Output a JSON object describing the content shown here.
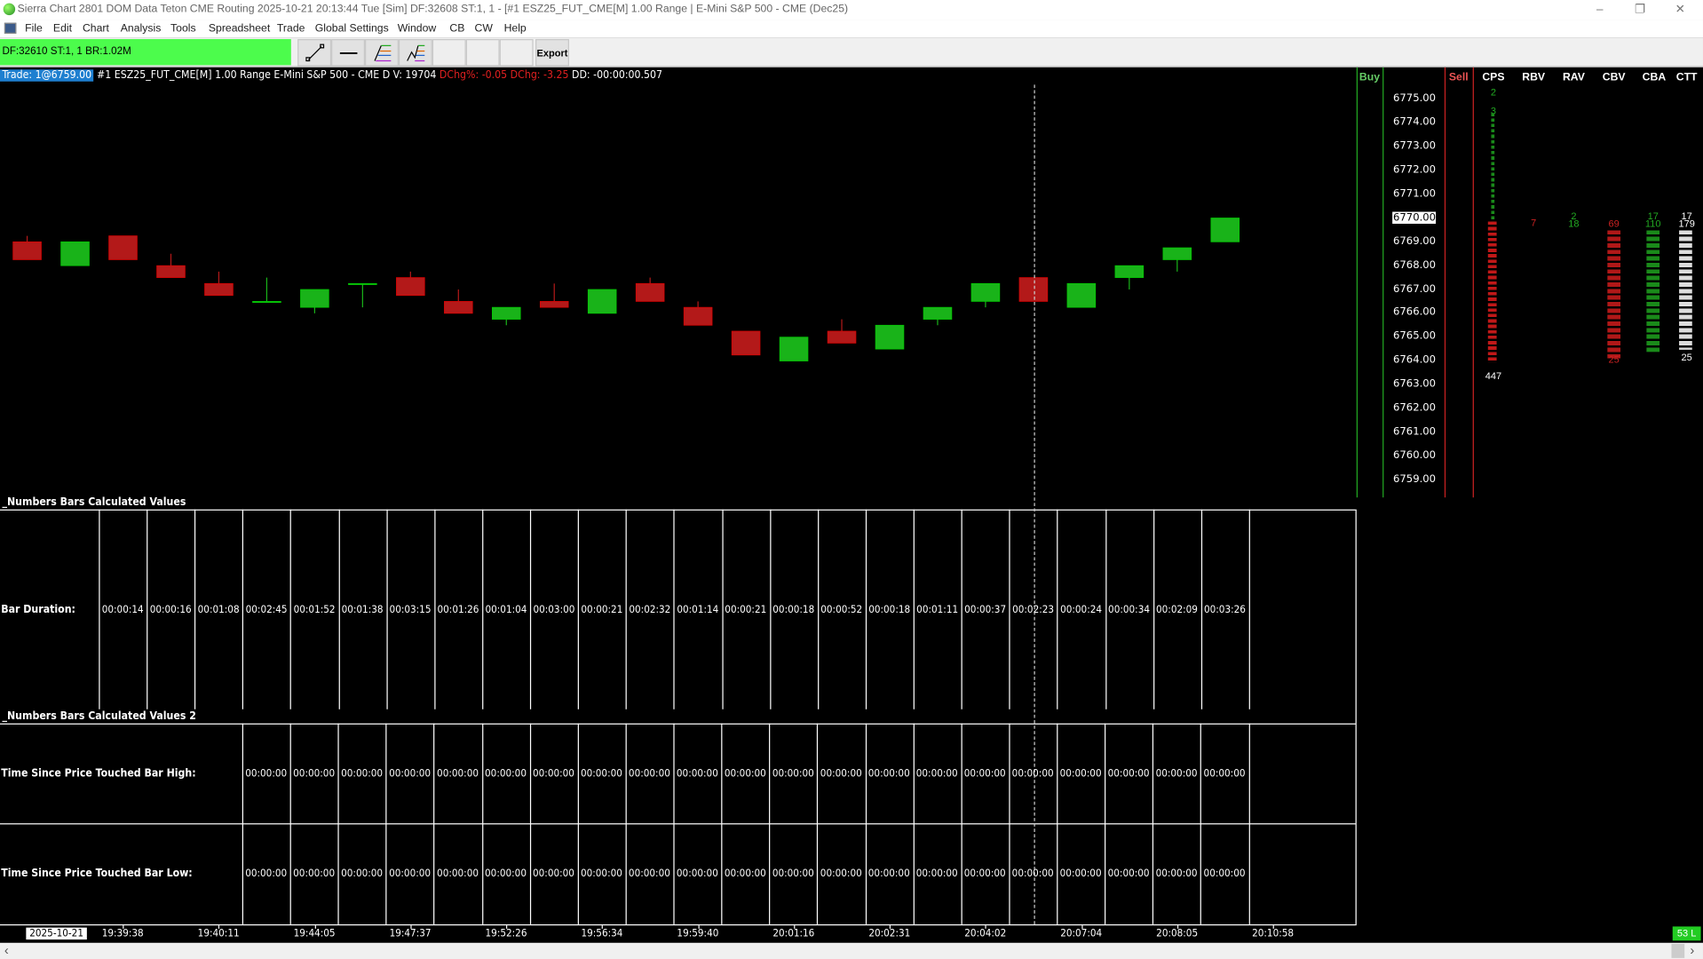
{
  "window": {
    "title": "Sierra Chart 2801 DOM Data Teton CME Routing 2025-10-21  20:13:44 Tue [Sim] DF:32608  ST:1, 1 - [#1 ESZ25_FUT_CME[M]  1.00 Range | E-Mini S&P 500 - CME (Dec25)",
    "minimize": "–",
    "restore": "❐",
    "close": "✕"
  },
  "menu": [
    "File",
    "Edit",
    "Chart",
    "Analysis",
    "Tools",
    "Spreadsheet",
    "Trade",
    "Global Settings",
    "Window",
    "CB",
    "CW",
    "Help"
  ],
  "toolbar": {
    "status": "DF:32610  ST:1, 1  BR:1.02M",
    "export_label": "Export",
    "tools": [
      "line-tool",
      "horizontal-line-tool",
      "fib-retracement-tool",
      "fib-extension-tool"
    ]
  },
  "info": {
    "trade": "Trade: 1@6759.00",
    "symbol": "#1 ESZ25_FUT_CME[M]  1.00 Range E-Mini S&P 500 - CME D V: 19704",
    "dchg_pct": "DChg%: -0.05",
    "dchg": "DChg: -3.25",
    "dd": "DD: -00:00:00.507"
  },
  "colors": {
    "up": "#19b319",
    "down": "#b31919",
    "status_green": "#4cfc4c",
    "trade_badge": "#1e7fd0"
  },
  "price_axis": {
    "labels": [
      "6775.00",
      "6774.00",
      "6773.00",
      "6772.00",
      "6771.00",
      "6770.00",
      "6769.00",
      "6768.00",
      "6767.00",
      "6766.00",
      "6765.00",
      "6764.00",
      "6763.00",
      "6762.00",
      "6761.00",
      "6760.00",
      "6759.00"
    ],
    "current": "6770.00"
  },
  "dom": {
    "headers": {
      "buy": "Buy",
      "sell": "Sell",
      "cps": "CPS",
      "rbv": "RBV",
      "rav": "RAV",
      "cbv": "CBV",
      "cba": "CBA",
      "ctt": "CTT"
    },
    "cps_top": "2",
    "cps_second": "3",
    "cps_total": "447",
    "rbv": "7",
    "rav_top": "2",
    "rav": "18",
    "cbv": "69",
    "cba_top": "17",
    "cba": "110",
    "ctt_top": "17",
    "ctt": "179",
    "ctt_bottom": "25",
    "cbv_bottom": "25"
  },
  "candles": [
    {
      "o": 6769.0,
      "h": 6769.25,
      "l": 6768.25,
      "c": 6768.25
    },
    {
      "o": 6768.0,
      "h": 6769.0,
      "l": 6768.0,
      "c": 6769.0
    },
    {
      "o": 6769.25,
      "h": 6769.25,
      "l": 6768.25,
      "c": 6768.25
    },
    {
      "o": 6768.0,
      "h": 6768.5,
      "l": 6767.5,
      "c": 6767.5
    },
    {
      "o": 6767.25,
      "h": 6767.75,
      "l": 6766.75,
      "c": 6766.75
    },
    {
      "o": 6766.5,
      "h": 6767.5,
      "l": 6766.5,
      "c": 6766.5
    },
    {
      "o": 6766.25,
      "h": 6767.0,
      "l": 6766.0,
      "c": 6767.0
    },
    {
      "o": 6767.25,
      "h": 6767.25,
      "l": 6766.25,
      "c": 6767.25
    },
    {
      "o": 6767.5,
      "h": 6767.75,
      "l": 6766.75,
      "c": 6766.75
    },
    {
      "o": 6766.5,
      "h": 6767.0,
      "l": 6766.0,
      "c": 6766.0
    },
    {
      "o": 6765.75,
      "h": 6766.25,
      "l": 6765.5,
      "c": 6766.25
    },
    {
      "o": 6766.5,
      "h": 6767.25,
      "l": 6766.25,
      "c": 6766.25
    },
    {
      "o": 6766.0,
      "h": 6767.0,
      "l": 6766.0,
      "c": 6767.0
    },
    {
      "o": 6767.25,
      "h": 6767.5,
      "l": 6766.5,
      "c": 6766.5
    },
    {
      "o": 6766.25,
      "h": 6766.5,
      "l": 6765.5,
      "c": 6765.5
    },
    {
      "o": 6765.25,
      "h": 6765.25,
      "l": 6764.25,
      "c": 6764.25
    },
    {
      "o": 6764.0,
      "h": 6765.0,
      "l": 6764.0,
      "c": 6765.0
    },
    {
      "o": 6765.25,
      "h": 6765.75,
      "l": 6764.75,
      "c": 6764.75
    },
    {
      "o": 6764.5,
      "h": 6765.5,
      "l": 6764.5,
      "c": 6765.5
    },
    {
      "o": 6765.75,
      "h": 6766.25,
      "l": 6765.5,
      "c": 6766.25
    },
    {
      "o": 6766.5,
      "h": 6767.25,
      "l": 6766.25,
      "c": 6767.25
    },
    {
      "o": 6767.5,
      "h": 6767.5,
      "l": 6766.5,
      "c": 6766.5
    },
    {
      "o": 6766.25,
      "h": 6767.25,
      "l": 6766.25,
      "c": 6767.25
    },
    {
      "o": 6767.5,
      "h": 6768.0,
      "l": 6767.0,
      "c": 6768.0
    },
    {
      "o": 6768.25,
      "h": 6768.75,
      "l": 6767.75,
      "c": 6768.75
    },
    {
      "o": 6769.0,
      "h": 6770.0,
      "l": 6769.0,
      "c": 6770.0
    }
  ],
  "study1": {
    "title": "_Numbers Bars Calculated Values",
    "row_label": "Bar Duration:",
    "values": [
      "00:00:14",
      "00:00:16",
      "00:01:08",
      "00:02:45",
      "00:01:52",
      "00:01:38",
      "00:03:15",
      "00:01:26",
      "00:01:04",
      "00:03:00",
      "00:00:21",
      "00:02:32",
      "00:01:14",
      "00:00:21",
      "00:00:18",
      "00:00:52",
      "00:00:18",
      "00:01:11",
      "00:00:37",
      "00:02:23",
      "00:00:24",
      "00:00:34",
      "00:02:09",
      "00:03:26"
    ]
  },
  "study2": {
    "title": "_Numbers Bars Calculated Values 2",
    "row1_label": "Time Since Price Touched Bar High:",
    "row2_label": "Time Since Price Touched Bar Low:",
    "value": "00:00:00",
    "count": 21
  },
  "time_axis": {
    "date": "2025-10-21",
    "labels": [
      "19:39:38",
      "19:40:11",
      "19:44:05",
      "19:47:37",
      "19:52:26",
      "19:56:34",
      "19:59:40",
      "20:01:16",
      "20:02:31",
      "20:04:02",
      "20:07:04",
      "20:08:05",
      "20:10:58"
    ]
  },
  "status_badge": "53 L",
  "scroll": {
    "left": "‹",
    "right": "›"
  }
}
